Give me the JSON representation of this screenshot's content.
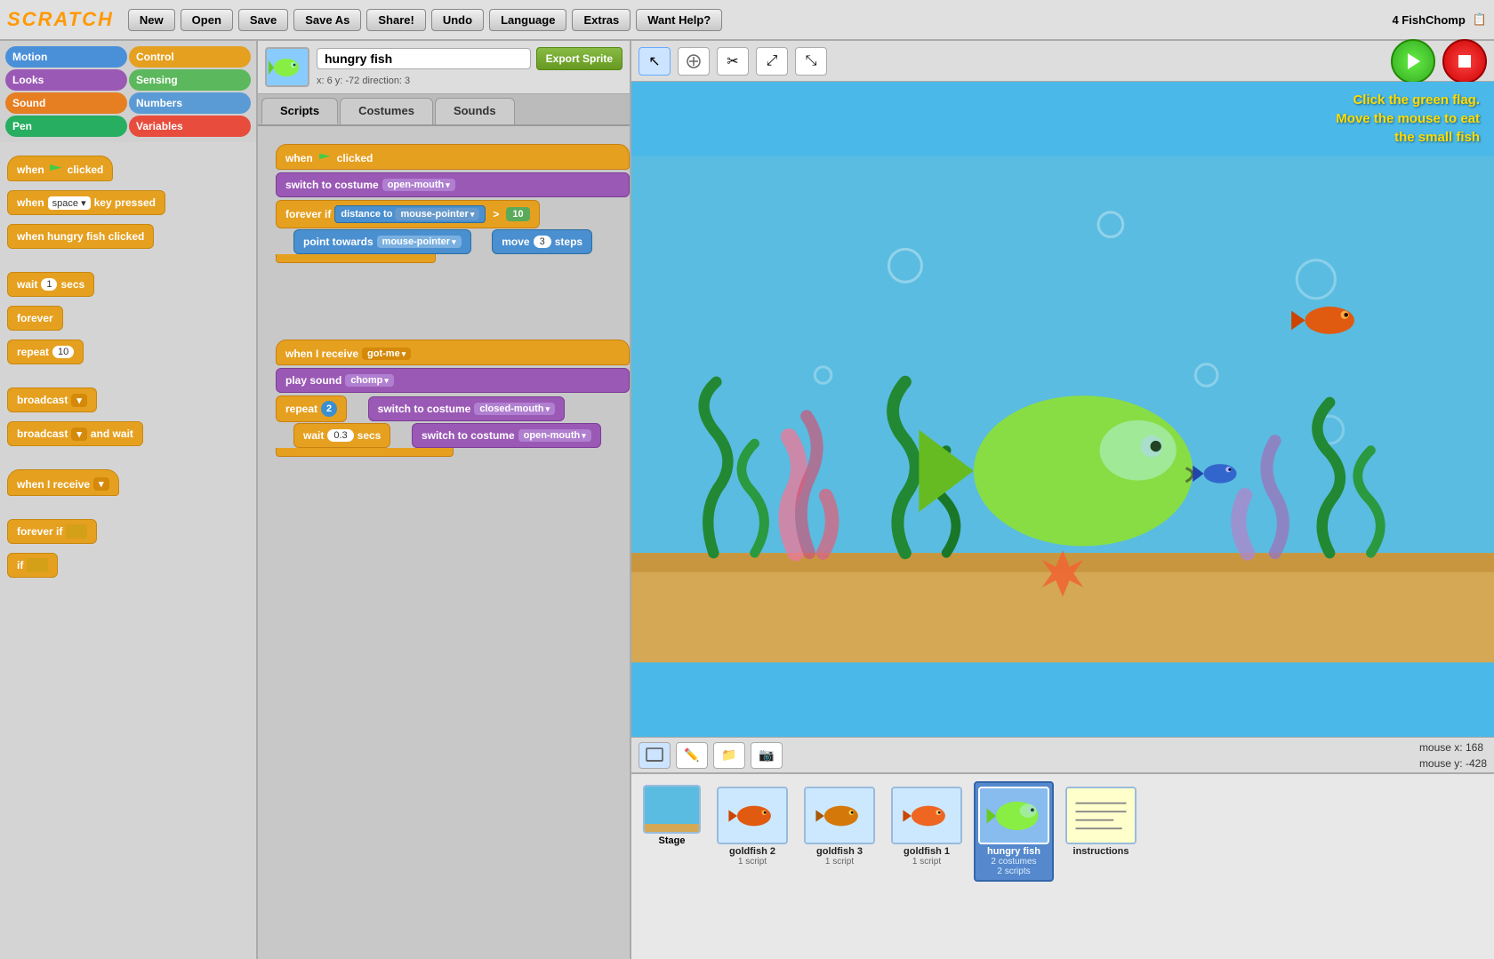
{
  "app": {
    "title": "SCRATCH",
    "project_name": "4 FishChomp"
  },
  "topbar": {
    "new_label": "New",
    "open_label": "Open",
    "save_label": "Save",
    "save_as_label": "Save As",
    "share_label": "Share!",
    "undo_label": "Undo",
    "language_label": "Language",
    "extras_label": "Extras",
    "help_label": "Want Help?"
  },
  "categories": [
    {
      "id": "motion",
      "label": "Motion",
      "class": "cat-motion"
    },
    {
      "id": "control",
      "label": "Control",
      "class": "cat-control"
    },
    {
      "id": "looks",
      "label": "Looks",
      "class": "cat-looks"
    },
    {
      "id": "sensing",
      "label": "Sensing",
      "class": "cat-sensing"
    },
    {
      "id": "sound",
      "label": "Sound",
      "class": "cat-sound"
    },
    {
      "id": "numbers",
      "label": "Numbers",
      "class": "cat-numbers"
    },
    {
      "id": "pen",
      "label": "Pen",
      "class": "cat-pen"
    },
    {
      "id": "variables",
      "label": "Variables",
      "class": "cat-variables"
    }
  ],
  "palette_blocks": [
    {
      "label": "when",
      "suffix": "clicked",
      "type": "hat"
    },
    {
      "label": "when",
      "input": "space",
      "suffix": "key pressed",
      "type": "key"
    },
    {
      "label": "when hungry fish clicked",
      "type": "event"
    },
    {
      "label": "wait",
      "input": "1",
      "suffix": "secs",
      "type": "basic"
    },
    {
      "label": "forever",
      "type": "c"
    },
    {
      "label": "repeat",
      "input": "10",
      "type": "c"
    },
    {
      "label": "broadcast",
      "dropdown": true,
      "type": "broadcast"
    },
    {
      "label": "broadcast",
      "dropdown": true,
      "suffix": "and wait",
      "type": "broadcast"
    },
    {
      "label": "when I receive",
      "dropdown": true,
      "type": "hat"
    },
    {
      "label": "forever if",
      "input_bool": true,
      "type": "c"
    },
    {
      "label": "if",
      "type": "c"
    }
  ],
  "sprite": {
    "name": "hungry fish",
    "x": "6",
    "y": "-72",
    "direction": "3",
    "coords_label": "x: 6   y: -72   direction: 3"
  },
  "tabs": [
    {
      "id": "scripts",
      "label": "Scripts"
    },
    {
      "id": "costumes",
      "label": "Costumes"
    },
    {
      "id": "sounds",
      "label": "Sounds"
    }
  ],
  "active_tab": "scripts",
  "scripts": [
    {
      "id": "script1",
      "blocks": [
        {
          "type": "hat-flag",
          "text": "when",
          "suffix": "clicked"
        },
        {
          "type": "c-block",
          "text": "switch to costume",
          "dropdown": "open-mouth"
        },
        {
          "type": "forever-if",
          "text": "forever if",
          "condition_text": "distance to",
          "condition_dropdown": "mouse-pointer",
          "op": ">",
          "val": "10"
        },
        {
          "type": "inner",
          "text": "point towards",
          "dropdown": "mouse-pointer"
        },
        {
          "type": "inner",
          "text": "move",
          "val": "3",
          "suffix": "steps"
        }
      ]
    },
    {
      "id": "script2",
      "blocks": [
        {
          "type": "hat-receive",
          "text": "when I receive",
          "dropdown": "got-me"
        },
        {
          "type": "c-block",
          "text": "play sound",
          "dropdown": "chomp"
        },
        {
          "type": "repeat",
          "val": "2"
        },
        {
          "type": "inner",
          "text": "switch to costume",
          "dropdown": "closed-mouth"
        },
        {
          "type": "inner",
          "text": "wait",
          "val": "0.3",
          "suffix": "secs"
        },
        {
          "type": "inner",
          "text": "switch to costume",
          "dropdown": "open-mouth"
        }
      ]
    }
  ],
  "stage": {
    "instruction_line1": "Click the green flag.",
    "instruction_line2": "Move the mouse to eat",
    "instruction_line3": "the small fish",
    "mouse_x": "168",
    "mouse_y": "-428",
    "mouse_x_label": "mouse x:",
    "mouse_y_label": "mouse y:"
  },
  "sprites": [
    {
      "id": "stage",
      "label": "Stage",
      "type": "stage"
    },
    {
      "id": "goldfish2",
      "label": "goldfish 2",
      "sublabel": "1 script"
    },
    {
      "id": "goldfish3",
      "label": "goldfish 3",
      "sublabel": "1 script"
    },
    {
      "id": "goldfish1",
      "label": "goldfish 1",
      "sublabel": "1 script"
    },
    {
      "id": "hungryfish",
      "label": "hungry fish",
      "sublabel1": "2 costumes",
      "sublabel2": "2 scripts",
      "active": true
    },
    {
      "id": "instructions",
      "label": "instructions",
      "sublabel": ""
    }
  ]
}
